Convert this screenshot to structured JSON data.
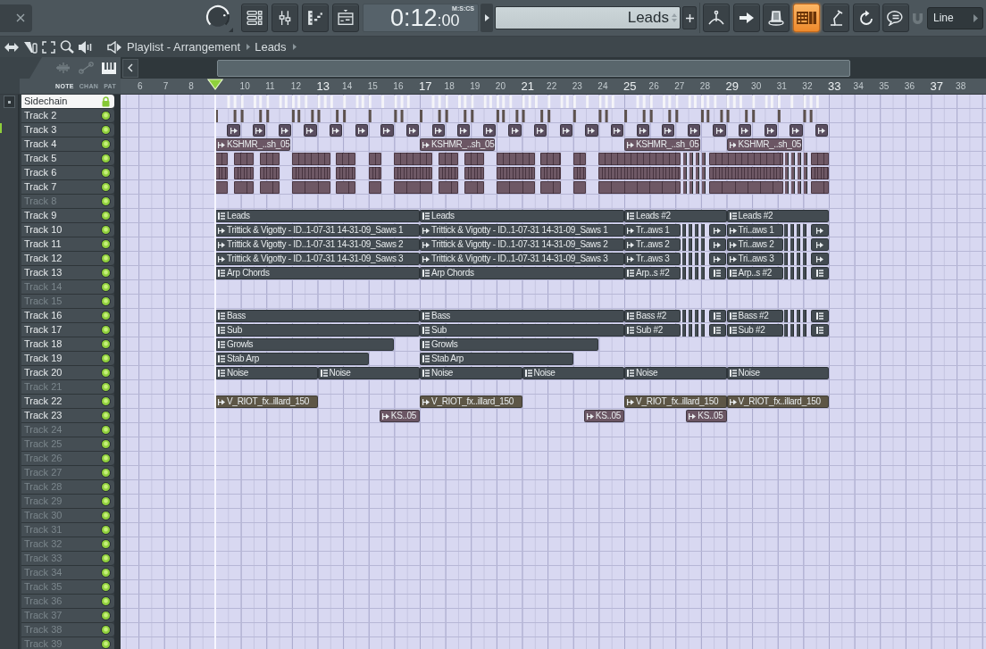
{
  "toolbar": {
    "knob": {
      "level": 0.78
    },
    "time": "0:12",
    "time_cs": ":00",
    "time_format": "M:S:CS",
    "pattern": "Leads",
    "tools": [
      {
        "selected": false
      },
      {
        "selected": false
      },
      {
        "selected": false
      },
      {
        "selected": true
      },
      {
        "selected": false
      },
      {
        "selected": false
      },
      {
        "selected": false
      }
    ],
    "snap": "Line"
  },
  "breadcrumb": [
    "Playlist - Arrangement",
    "Leads"
  ],
  "view_tabs": [
    {
      "label": "NOTE",
      "selected": true
    },
    {
      "label": "CHAN",
      "selected": false
    },
    {
      "label": "PAT",
      "selected": false
    }
  ],
  "ruler": {
    "before_playhead": [
      {
        "label": "6",
        "major": false
      },
      {
        "label": "7",
        "major": false
      },
      {
        "label": "8",
        "major": false
      }
    ],
    "after_playhead": [
      {
        "label": "10",
        "major": false
      },
      {
        "label": "11",
        "major": false
      },
      {
        "label": "12",
        "major": false
      },
      {
        "label": "13",
        "major": true
      },
      {
        "label": "14",
        "major": false
      },
      {
        "label": "15",
        "major": false
      },
      {
        "label": "16",
        "major": false
      },
      {
        "label": "17",
        "major": true
      },
      {
        "label": "18",
        "major": false
      },
      {
        "label": "19",
        "major": false
      },
      {
        "label": "20",
        "major": false
      },
      {
        "label": "21",
        "major": true
      },
      {
        "label": "22",
        "major": false
      },
      {
        "label": "23",
        "major": false
      },
      {
        "label": "24",
        "major": false
      },
      {
        "label": "25",
        "major": true
      },
      {
        "label": "26",
        "major": false
      },
      {
        "label": "27",
        "major": false
      },
      {
        "label": "28",
        "major": false
      },
      {
        "label": "29",
        "major": true
      },
      {
        "label": "30",
        "major": false
      },
      {
        "label": "31",
        "major": false
      },
      {
        "label": "32",
        "major": false
      },
      {
        "label": "33",
        "major": true
      },
      {
        "label": "34",
        "major": false
      },
      {
        "label": "35",
        "major": false
      },
      {
        "label": "36",
        "major": false
      },
      {
        "label": "37",
        "major": true
      },
      {
        "label": "38",
        "major": false
      }
    ]
  },
  "tracks": [
    {
      "name": "Sidechain",
      "selected": true,
      "locked": true,
      "enabled": true,
      "kind": "ticks",
      "color": "#f4f4f8"
    },
    {
      "name": "Track 2",
      "selected": false,
      "locked": false,
      "enabled": true,
      "kind": "ticks",
      "color": "#5d524e"
    },
    {
      "name": "Track 3",
      "selected": false,
      "locked": false,
      "enabled": true,
      "kind": "clips",
      "color": "#5a4e60",
      "clips": [
        {
          "kind": "audio"
        },
        {
          "kind": "audio"
        },
        {
          "kind": "audio"
        },
        {
          "kind": "audio"
        },
        {
          "kind": "audio"
        },
        {
          "kind": "audio"
        },
        {
          "kind": "audio"
        },
        {
          "kind": "audio"
        },
        {
          "kind": "audio"
        },
        {
          "kind": "audio"
        },
        {
          "kind": "audio"
        },
        {
          "kind": "audio"
        },
        {
          "kind": "audio"
        },
        {
          "kind": "audio"
        },
        {
          "kind": "audio"
        },
        {
          "kind": "audio"
        },
        {
          "kind": "audio"
        },
        {
          "kind": "audio"
        },
        {
          "kind": "audio"
        },
        {
          "kind": "audio"
        },
        {
          "kind": "audio"
        },
        {
          "kind": "audio"
        },
        {
          "kind": "audio"
        },
        {
          "kind": "audio"
        }
      ]
    },
    {
      "name": "Track 4",
      "selected": false,
      "locked": false,
      "enabled": true,
      "kind": "clips",
      "color": "#6b5664",
      "clips": [
        {
          "kind": "audio",
          "label": "KSHMR_..sh_05"
        },
        {
          "kind": "audio",
          "label": "KSHMR_..sh_05"
        },
        {
          "kind": "audio",
          "label": "KSHMR_..sh_05"
        },
        {
          "kind": "audio",
          "label": "KSHMR_..sh_05"
        }
      ]
    },
    {
      "name": "Track 5",
      "selected": false,
      "locked": false,
      "enabled": true,
      "kind": "chops",
      "color": "#6e5865"
    },
    {
      "name": "Track 6",
      "selected": false,
      "locked": false,
      "enabled": true,
      "kind": "chops",
      "color": "#6e5865"
    },
    {
      "name": "Track 7",
      "selected": false,
      "locked": false,
      "enabled": true,
      "kind": "chops",
      "color": "#6e5865"
    },
    {
      "name": "Track 8",
      "selected": false,
      "locked": false,
      "enabled": true,
      "kind": "empty"
    },
    {
      "name": "Track 9",
      "selected": false,
      "locked": false,
      "enabled": true,
      "kind": "clips",
      "color": "#434b51",
      "clips": [
        {
          "kind": "pattern",
          "label": "Leads"
        },
        {
          "kind": "pattern",
          "label": "Leads"
        },
        {
          "kind": "pattern",
          "label": "Leads #2"
        },
        {
          "kind": "pattern",
          "label": "Leads #2"
        }
      ]
    },
    {
      "name": "Track 10",
      "selected": false,
      "locked": false,
      "enabled": true,
      "kind": "clips",
      "color": "#434b51",
      "clips": [
        {
          "kind": "audio",
          "label": "Trittick & Vigotty - ID..1-07-31 14-31-09_Saws 1"
        },
        {
          "kind": "audio",
          "label": "Trittick & Vigotty - ID..1-07-31 14-31-09_Saws 1"
        },
        {
          "kind": "audio",
          "label": "Tr..aws 1"
        },
        {
          "kind": "audio"
        },
        {
          "kind": "audio",
          "label": "Tri..aws 1"
        },
        {
          "kind": "audio"
        }
      ]
    },
    {
      "name": "Track 11",
      "selected": false,
      "locked": false,
      "enabled": true,
      "kind": "clips",
      "color": "#434b51",
      "clips": [
        {
          "kind": "audio",
          "label": "Trittick & Vigotty - ID..1-07-31 14-31-09_Saws 2"
        },
        {
          "kind": "audio",
          "label": "Trittick & Vigotty - ID..1-07-31 14-31-09_Saws 2"
        },
        {
          "kind": "audio",
          "label": "Tr..aws 2"
        },
        {
          "kind": "audio"
        },
        {
          "kind": "audio",
          "label": "Tri..aws 2"
        },
        {
          "kind": "audio"
        }
      ]
    },
    {
      "name": "Track 12",
      "selected": false,
      "locked": false,
      "enabled": true,
      "kind": "clips",
      "color": "#434b51",
      "clips": [
        {
          "kind": "audio",
          "label": "Trittick & Vigotty - ID..1-07-31 14-31-09_Saws 3"
        },
        {
          "kind": "audio",
          "label": "Trittick & Vigotty - ID..1-07-31 14-31-09_Saws 3"
        },
        {
          "kind": "audio",
          "label": "Tr..aws 3"
        },
        {
          "kind": "audio"
        },
        {
          "kind": "audio",
          "label": "Tri..aws 3"
        },
        {
          "kind": "audio"
        }
      ]
    },
    {
      "name": "Track 13",
      "selected": false,
      "locked": false,
      "enabled": true,
      "kind": "clips",
      "color": "#434b51",
      "clips": [
        {
          "kind": "pattern",
          "label": "Arp Chords"
        },
        {
          "kind": "pattern",
          "label": "Arp Chords"
        },
        {
          "kind": "pattern",
          "label": "Arp..s #2"
        },
        {
          "kind": "pattern"
        },
        {
          "kind": "pattern",
          "label": "Arp..s #2"
        },
        {
          "kind": "pattern"
        }
      ]
    },
    {
      "name": "Track 14",
      "selected": false,
      "locked": false,
      "enabled": true,
      "kind": "empty"
    },
    {
      "name": "Track 15",
      "selected": false,
      "locked": false,
      "enabled": true,
      "kind": "empty"
    },
    {
      "name": "Track 16",
      "selected": false,
      "locked": false,
      "enabled": true,
      "kind": "clips",
      "color": "#434b51",
      "clips": [
        {
          "kind": "pattern",
          "label": "Bass"
        },
        {
          "kind": "pattern",
          "label": "Bass"
        },
        {
          "kind": "pattern",
          "label": "Bass #2"
        },
        {
          "kind": "pattern"
        },
        {
          "kind": "pattern",
          "label": "Bass #2"
        },
        {
          "kind": "pattern"
        }
      ]
    },
    {
      "name": "Track 17",
      "selected": false,
      "locked": false,
      "enabled": true,
      "kind": "clips",
      "color": "#434b51",
      "clips": [
        {
          "kind": "pattern",
          "label": "Sub"
        },
        {
          "kind": "pattern",
          "label": "Sub"
        },
        {
          "kind": "pattern",
          "label": "Sub #2"
        },
        {
          "kind": "pattern"
        },
        {
          "kind": "pattern",
          "label": "Sub #2"
        },
        {
          "kind": "pattern"
        }
      ]
    },
    {
      "name": "Track 18",
      "selected": false,
      "locked": false,
      "enabled": true,
      "kind": "clips",
      "color": "#434b51",
      "clips": [
        {
          "kind": "pattern",
          "label": "Growls"
        },
        {
          "kind": "pattern",
          "label": "Growls"
        }
      ]
    },
    {
      "name": "Track 19",
      "selected": false,
      "locked": false,
      "enabled": true,
      "kind": "clips",
      "color": "#434b51",
      "clips": [
        {
          "kind": "pattern",
          "label": "Stab Arp"
        },
        {
          "kind": "pattern",
          "label": "Stab Arp"
        }
      ]
    },
    {
      "name": "Track 20",
      "selected": false,
      "locked": false,
      "enabled": true,
      "kind": "clips",
      "color": "#434b51",
      "clips": [
        {
          "kind": "pattern",
          "label": "Noise"
        },
        {
          "kind": "pattern",
          "label": "Noise"
        },
        {
          "kind": "pattern",
          "label": "Noise"
        },
        {
          "kind": "pattern",
          "label": "Noise"
        },
        {
          "kind": "pattern",
          "label": "Noise"
        },
        {
          "kind": "pattern",
          "label": "Noise"
        }
      ]
    },
    {
      "name": "Track 21",
      "selected": false,
      "locked": false,
      "enabled": true,
      "kind": "empty"
    },
    {
      "name": "Track 22",
      "selected": false,
      "locked": false,
      "enabled": true,
      "kind": "clips",
      "color": "#5d5646",
      "clips": [
        {
          "kind": "audio",
          "label": "V_RIOT_fx..illard_150"
        },
        {
          "kind": "audio",
          "label": "V_RIOT_fx..illard_150"
        },
        {
          "kind": "audio",
          "label": "V_RIOT_fx..illard_150"
        },
        {
          "kind": "audio",
          "label": "V_RIOT_fx..illard_150"
        }
      ]
    },
    {
      "name": "Track 23",
      "selected": false,
      "locked": false,
      "enabled": true,
      "kind": "clips",
      "color": "#6b5664",
      "clips": [
        {
          "kind": "audio",
          "label": "KS..05"
        },
        {
          "kind": "audio",
          "label": "KS..05"
        },
        {
          "kind": "audio",
          "label": "KS..05"
        }
      ]
    },
    {
      "name": "Track 24",
      "selected": false,
      "locked": false,
      "enabled": true,
      "kind": "empty"
    },
    {
      "name": "Track 25",
      "selected": false,
      "locked": false,
      "enabled": true,
      "kind": "empty"
    },
    {
      "name": "Track 26",
      "selected": false,
      "locked": false,
      "enabled": true,
      "kind": "empty"
    },
    {
      "name": "Track 27",
      "selected": false,
      "locked": false,
      "enabled": true,
      "kind": "empty"
    },
    {
      "name": "Track 28",
      "selected": false,
      "locked": false,
      "enabled": true,
      "kind": "empty"
    },
    {
      "name": "Track 29",
      "selected": false,
      "locked": false,
      "enabled": true,
      "kind": "empty"
    },
    {
      "name": "Track 30",
      "selected": false,
      "locked": false,
      "enabled": true,
      "kind": "empty"
    },
    {
      "name": "Track 31",
      "selected": false,
      "locked": false,
      "enabled": true,
      "kind": "empty"
    },
    {
      "name": "Track 32",
      "selected": false,
      "locked": false,
      "enabled": true,
      "kind": "empty"
    },
    {
      "name": "Track 33",
      "selected": false,
      "locked": false,
      "enabled": true,
      "kind": "empty"
    },
    {
      "name": "Track 34",
      "selected": false,
      "locked": false,
      "enabled": true,
      "kind": "empty"
    },
    {
      "name": "Track 35",
      "selected": false,
      "locked": false,
      "enabled": true,
      "kind": "empty"
    },
    {
      "name": "Track 36",
      "selected": false,
      "locked": false,
      "enabled": true,
      "kind": "empty"
    },
    {
      "name": "Track 37",
      "selected": false,
      "locked": false,
      "enabled": true,
      "kind": "empty"
    },
    {
      "name": "Track 38",
      "selected": false,
      "locked": false,
      "enabled": true,
      "kind": "empty"
    },
    {
      "name": "Track 39",
      "selected": false,
      "locked": false,
      "enabled": true,
      "kind": "empty"
    }
  ]
}
